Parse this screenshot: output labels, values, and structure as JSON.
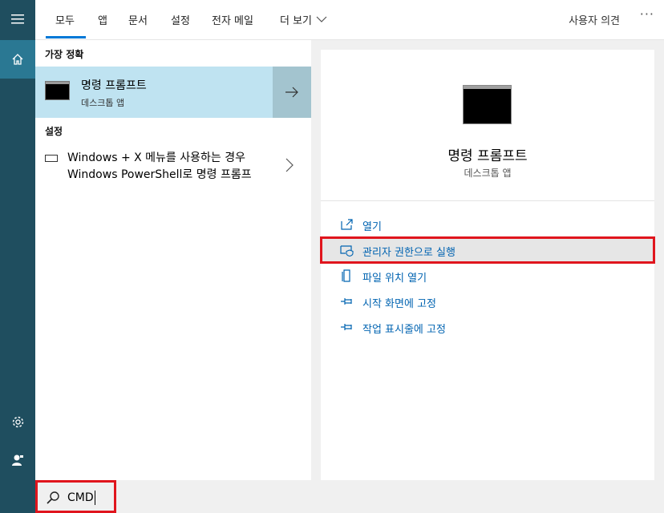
{
  "tabs": [
    "모두",
    "앱",
    "문서",
    "설정",
    "전자 메일",
    "더 보기"
  ],
  "header": {
    "feedback": "사용자 의견",
    "more_options": "···"
  },
  "best_match": {
    "header": "가장 정확",
    "title": "명령 프롬프트",
    "subtitle": "데스크톱 앱"
  },
  "settings": {
    "header": "설정",
    "item": "Windows + X 메뉴를 사용하는 경우 Windows PowerShell로 명령 프롬프"
  },
  "preview": {
    "title": "명령 프롬프트",
    "subtitle": "데스크톱 앱",
    "actions": [
      {
        "label": "열기",
        "icon": "open-icon"
      },
      {
        "label": "관리자 권한으로 실행",
        "icon": "shield-icon"
      },
      {
        "label": "파일 위치 열기",
        "icon": "file-location-icon"
      },
      {
        "label": "시작 화면에 고정",
        "icon": "pin-icon"
      },
      {
        "label": "작업 표시줄에 고정",
        "icon": "pin-icon"
      }
    ]
  },
  "search": {
    "value": "CMD"
  },
  "colors": {
    "accent": "#0078d7",
    "highlight": "#e0151d",
    "sidebar": "#1f4e5f",
    "best_bg": "#bfe3f1"
  }
}
